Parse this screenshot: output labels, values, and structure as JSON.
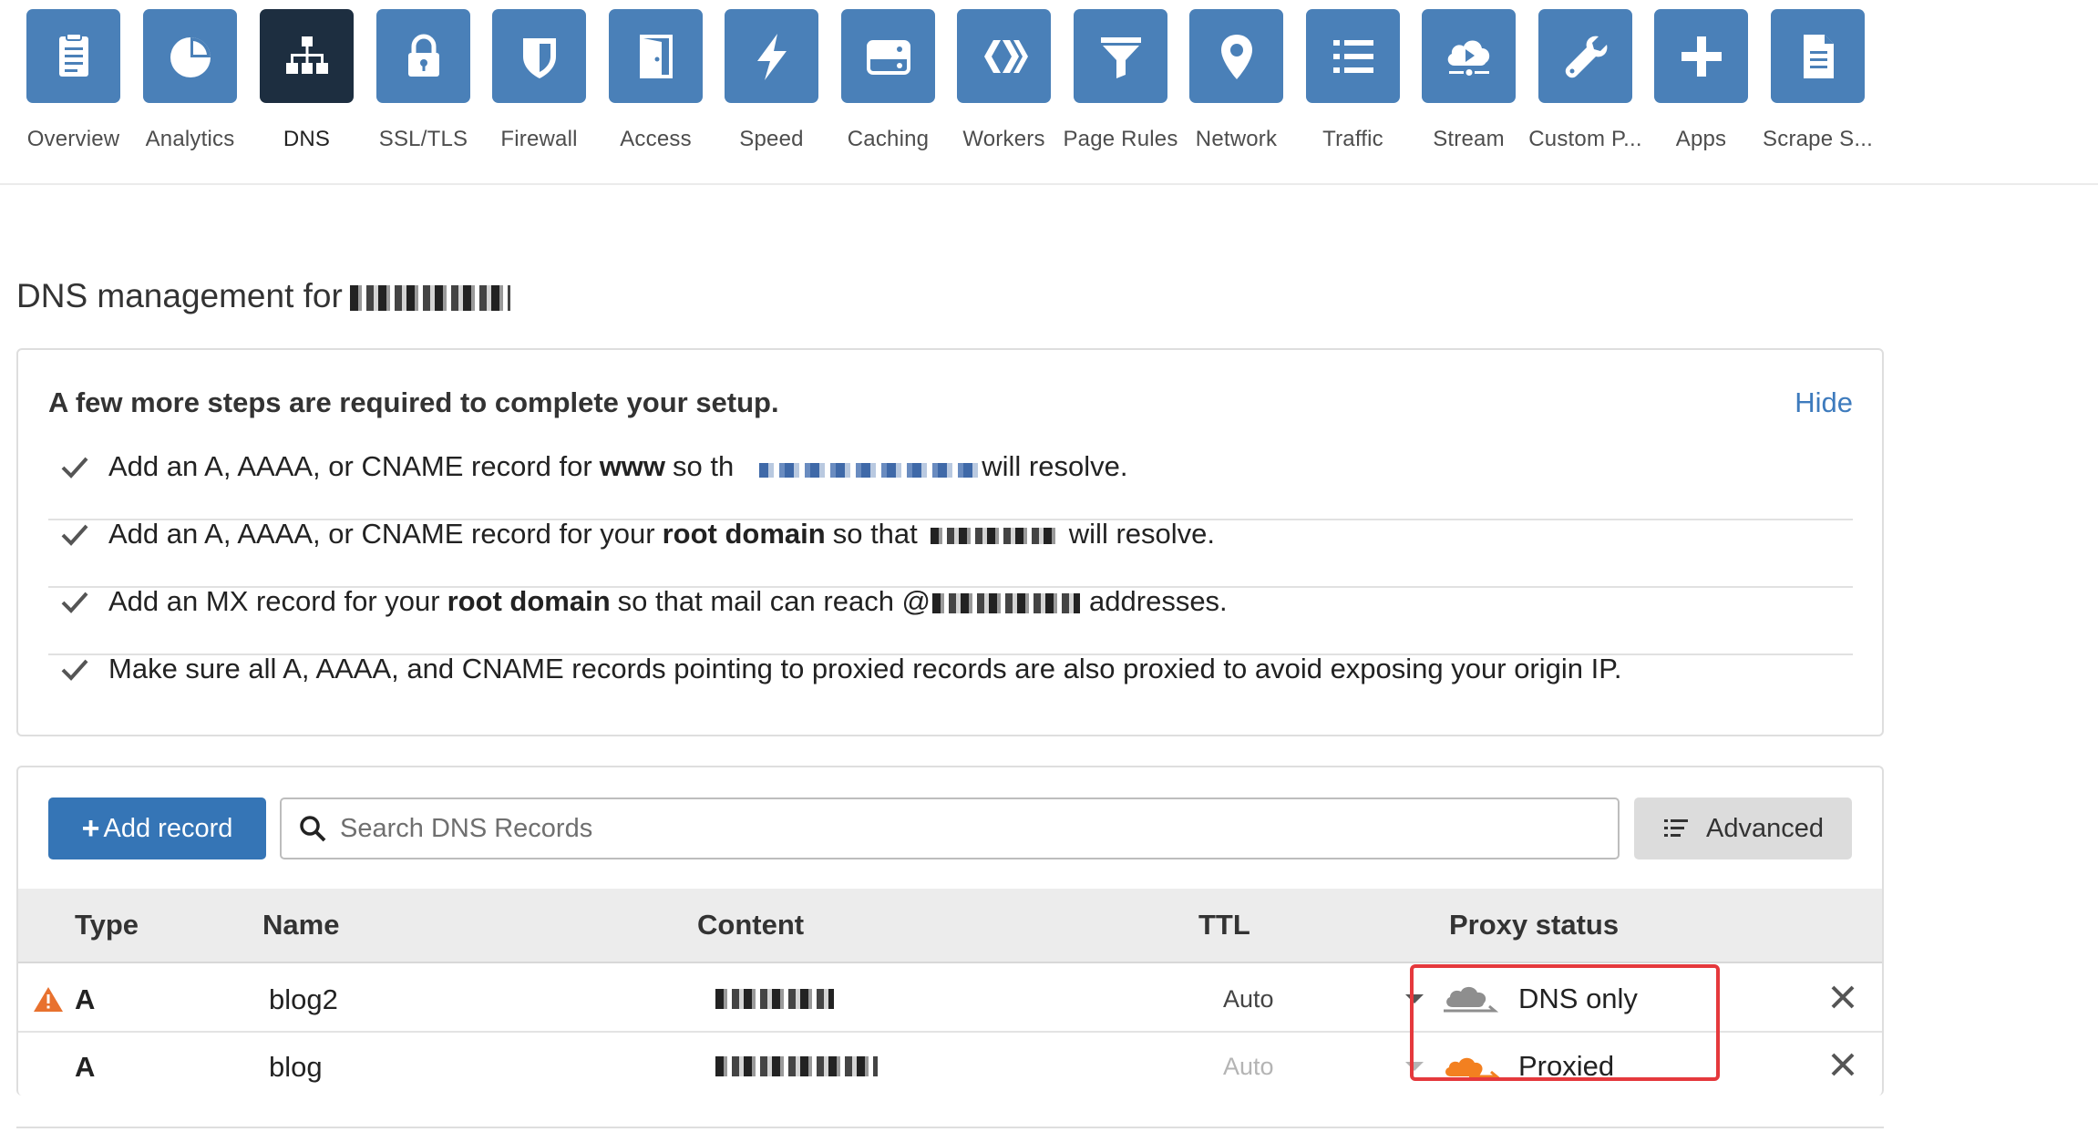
{
  "nav": {
    "items": [
      {
        "label": "Overview",
        "icon": "clipboard-icon",
        "active": false
      },
      {
        "label": "Analytics",
        "icon": "pie-chart-icon",
        "active": false
      },
      {
        "label": "DNS",
        "icon": "network-tree-icon",
        "active": true
      },
      {
        "label": "SSL/TLS",
        "icon": "lock-icon",
        "active": false
      },
      {
        "label": "Firewall",
        "icon": "shield-icon",
        "active": false
      },
      {
        "label": "Access",
        "icon": "door-icon",
        "active": false
      },
      {
        "label": "Speed",
        "icon": "lightning-icon",
        "active": false
      },
      {
        "label": "Caching",
        "icon": "server-drive-icon",
        "active": false
      },
      {
        "label": "Workers",
        "icon": "workers-chevrons-icon",
        "active": false
      },
      {
        "label": "Page Rules",
        "icon": "funnel-icon",
        "active": false
      },
      {
        "label": "Network",
        "icon": "map-pin-icon",
        "active": false
      },
      {
        "label": "Traffic",
        "icon": "list-icon",
        "active": false
      },
      {
        "label": "Stream",
        "icon": "cloud-play-icon",
        "active": false
      },
      {
        "label": "Custom P...",
        "icon": "wrench-icon",
        "active": false
      },
      {
        "label": "Apps",
        "icon": "plus-icon",
        "active": false
      },
      {
        "label": "Scrape S...",
        "icon": "document-icon",
        "active": false
      }
    ]
  },
  "page": {
    "title": "DNS management for"
  },
  "setup": {
    "title": "A few more steps are required to complete your setup.",
    "hide_label": "Hide",
    "steps": [
      {
        "pre": "Add an A, AAAA, or CNAME record for",
        "bold": "www",
        "post": "so th",
        "tail": "will resolve."
      },
      {
        "pre": "Add an A, AAAA, or CNAME record for your",
        "bold": "root domain",
        "post": "so that",
        "tail": "will resolve."
      },
      {
        "pre": "Add an MX record for your",
        "bold": "root domain",
        "post": "so that mail can reach @",
        "tail": "addresses."
      },
      {
        "pre": "Make sure all A, AAAA, and CNAME records pointing to proxied records are also proxied to avoid exposing your origin IP.",
        "bold": "",
        "post": "",
        "tail": ""
      }
    ]
  },
  "toolbar": {
    "add_record_label": "Add record",
    "search_placeholder": "Search DNS Records",
    "advanced_label": "Advanced"
  },
  "table": {
    "headers": {
      "type": "Type",
      "name": "Name",
      "content": "Content",
      "ttl": "TTL",
      "proxy": "Proxy status"
    },
    "rows": [
      {
        "type": "A",
        "name": "blog2",
        "ttl": "Auto",
        "proxy": "DNS only",
        "warning": true
      },
      {
        "type": "A",
        "name": "blog",
        "ttl": "Auto",
        "proxy": "Proxied",
        "warning": false
      }
    ]
  },
  "colors": {
    "nav_tile": "#4a80b8",
    "nav_tile_active": "#1d2e40",
    "primary_button": "#3575b6",
    "link": "#3e7bbd",
    "highlight_box": "#e5393d",
    "proxied_cloud": "#f38020",
    "dns_only_cloud": "#8e8e8e",
    "warning": "#e8712e"
  }
}
